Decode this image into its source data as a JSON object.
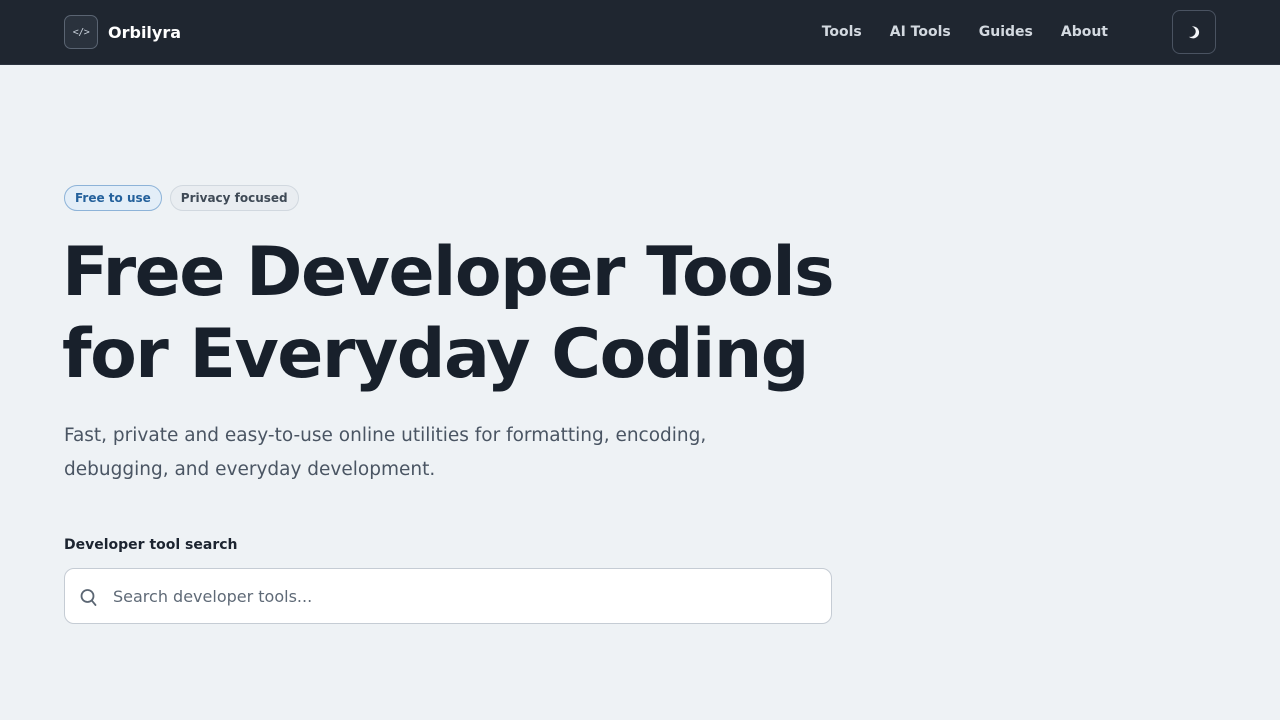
{
  "header": {
    "logo_glyph": "</>",
    "brand_name": "Orbilyra",
    "nav": [
      {
        "label": "Tools"
      },
      {
        "label": "AI Tools"
      },
      {
        "label": "Guides"
      },
      {
        "label": "About"
      }
    ],
    "theme_toggle_icon": "half-moon-icon"
  },
  "hero": {
    "badges": [
      {
        "label": "Free to use"
      },
      {
        "label": "Privacy focused"
      }
    ],
    "title_line1": "Free Developer Tools",
    "title_line2": "for Everyday Coding",
    "subtitle_line1": "Fast, private and easy-to-use online utilities for formatting, encoding,",
    "subtitle_line2": "debugging, and everyday development."
  },
  "search": {
    "label": "Developer tool search",
    "placeholder": "Search developer tools...",
    "value": "",
    "icon": "search-icon"
  },
  "colors": {
    "header_bg": "#1f2630",
    "page_bg": "#eef2f5",
    "accent": "#24619c",
    "title": "#18202b"
  }
}
